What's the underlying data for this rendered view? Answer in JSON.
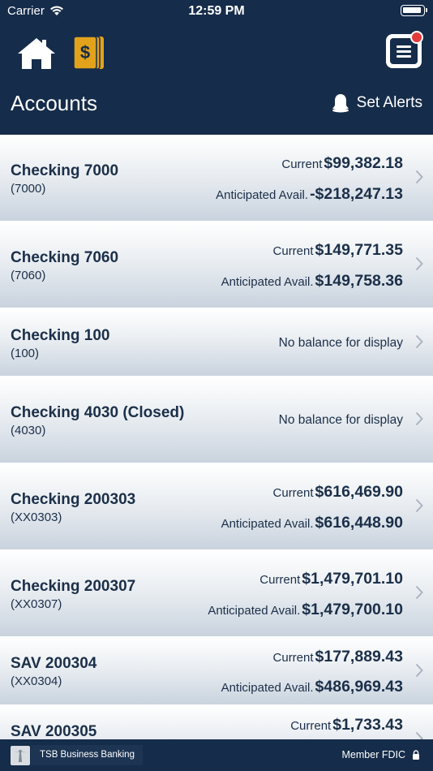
{
  "status": {
    "carrier": "Carrier",
    "time": "12:59 PM"
  },
  "header": {
    "title": "Accounts",
    "alerts_label": "Set Alerts"
  },
  "accounts": [
    {
      "name": "Checking 7000",
      "number": "(7000)",
      "current_label": "Current",
      "current": "$99,382.18",
      "avail_label": "Anticipated Avail.",
      "avail": "-$218,247.13"
    },
    {
      "name": "Checking 7060",
      "number": "(7060)",
      "current_label": "Current",
      "current": "$149,771.35",
      "avail_label": "Anticipated Avail.",
      "avail": "$149,758.36"
    },
    {
      "name": "Checking 100",
      "number": "(100)",
      "no_balance": "No balance for display"
    },
    {
      "name": "Checking 4030 (Closed)",
      "number": "(4030)",
      "no_balance": "No balance for display"
    },
    {
      "name": "Checking 200303",
      "number": "(XX0303)",
      "current_label": "Current",
      "current": "$616,469.90",
      "avail_label": "Anticipated Avail.",
      "avail": "$616,448.90"
    },
    {
      "name": "Checking 200307",
      "number": "(XX0307)",
      "current_label": "Current",
      "current": "$1,479,701.10",
      "avail_label": "Anticipated Avail.",
      "avail": "$1,479,700.10"
    },
    {
      "name": "SAV 200304",
      "number": "(XX0304)",
      "current_label": "Current",
      "current": "$177,889.43",
      "avail_label": "Anticipated Avail.",
      "avail": "$486,969.43"
    },
    {
      "name": "SAV 200305",
      "current_label": "Current",
      "current": "$1,733.43"
    }
  ],
  "footer": {
    "brand": "TSB Business Banking",
    "fdic": "Member FDIC"
  },
  "colors": {
    "navy": "#152c4a",
    "text": "#1b2f49",
    "badge": "#e33b3b",
    "gold": "#e2a21c"
  }
}
